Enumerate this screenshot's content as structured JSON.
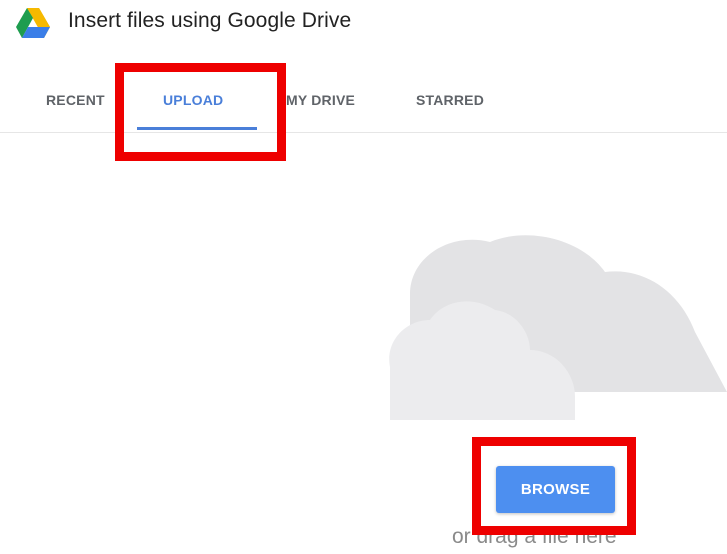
{
  "header": {
    "title": "Insert files using Google Drive",
    "logo_icon": "google-drive-icon"
  },
  "tabs": [
    {
      "label": "RECENT",
      "active": false
    },
    {
      "label": "UPLOAD",
      "active": true
    },
    {
      "label": "MY DRIVE",
      "active": false
    },
    {
      "label": "STARRED",
      "active": false
    }
  ],
  "upload": {
    "illustration_icon": "cloud-icon",
    "browse_label": "BROWSE",
    "drag_hint": "or drag a file here"
  },
  "colors": {
    "accent": "#4a7fd9",
    "button": "#4d8ff0",
    "highlight": "#ee0000",
    "cloud": "#e3e3e5"
  }
}
